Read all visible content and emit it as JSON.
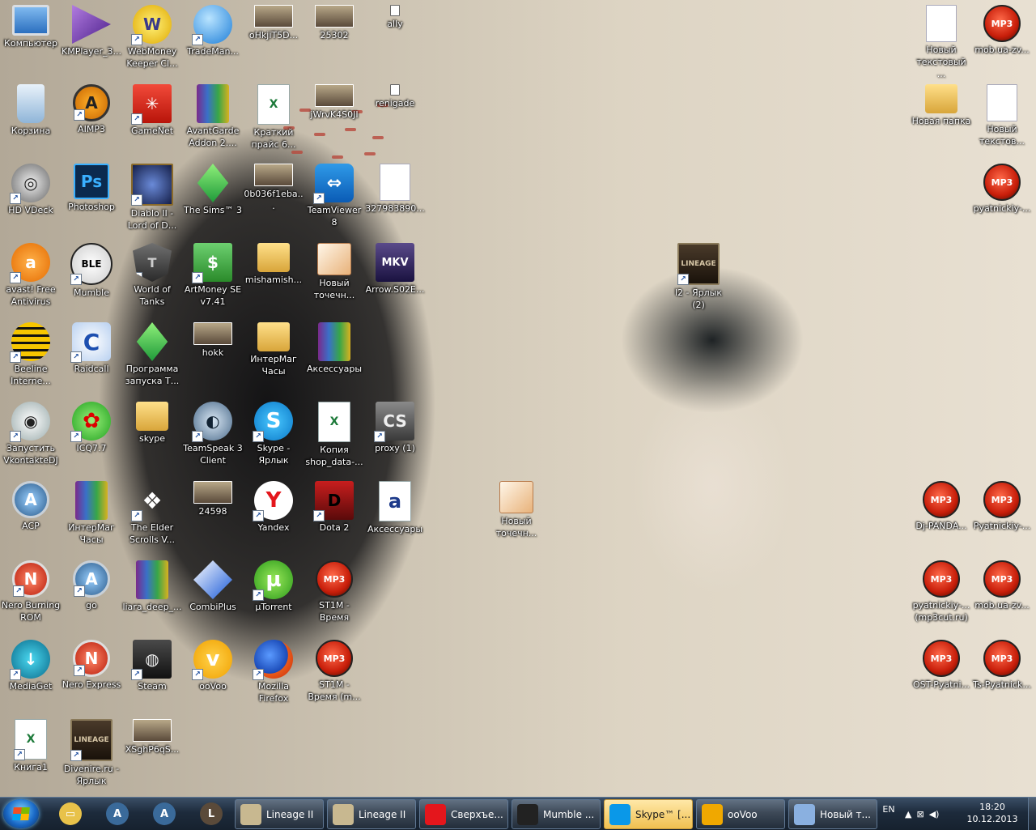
{
  "desktop": {
    "icons": [
      {
        "label": "Компьютер",
        "glyph": "",
        "icon": "computer-icon",
        "style": "g-comp",
        "col": 0,
        "row": 0,
        "shortcut": false
      },
      {
        "label": "KMPlayer_3...",
        "glyph": "",
        "icon": "kmplayer-icon",
        "style": "g-km",
        "col": 1,
        "row": 0,
        "shortcut": false
      },
      {
        "label": "WebMoney Keeper Cl...",
        "glyph": "W",
        "icon": "webmoney-icon",
        "style": "g-wm",
        "col": 2,
        "row": 0,
        "shortcut": true
      },
      {
        "label": "TradeMan...",
        "glyph": "",
        "icon": "trademan-icon",
        "style": "g-trade",
        "col": 3,
        "row": 0,
        "shortcut": true
      },
      {
        "label": "oHkjiT5D...",
        "glyph": "",
        "icon": "image-file-icon",
        "style": "g-img",
        "col": 4,
        "row": 0,
        "shortcut": false
      },
      {
        "label": "25302",
        "glyph": "",
        "icon": "image-file-icon",
        "style": "g-img",
        "col": 5,
        "row": 0,
        "shortcut": false
      },
      {
        "label": "ally",
        "glyph": "",
        "icon": "small-file-icon",
        "style": "g-small",
        "col": 6,
        "row": 0,
        "shortcut": false
      },
      {
        "label": "Корзина",
        "glyph": "",
        "icon": "recycle-bin-icon",
        "style": "g-recycle",
        "col": 0,
        "row": 1,
        "shortcut": false
      },
      {
        "label": "AIMP3",
        "glyph": "A",
        "icon": "aimp-icon",
        "style": "g-aimp",
        "col": 1,
        "row": 1,
        "shortcut": true
      },
      {
        "label": "GameNet",
        "glyph": "✳",
        "icon": "gamenet-icon",
        "style": "g-gamenet",
        "col": 2,
        "row": 1,
        "shortcut": true
      },
      {
        "label": "AvantGarde Addon 2....",
        "glyph": "",
        "icon": "winrar-archive-icon",
        "style": "g-rar",
        "col": 3,
        "row": 1,
        "shortcut": false
      },
      {
        "label": "Краткий прайс 6...",
        "glyph": "X",
        "icon": "excel-file-icon",
        "style": "g-excel",
        "col": 4,
        "row": 1,
        "shortcut": false
      },
      {
        "label": "jWrvK4S0JI",
        "glyph": "",
        "icon": "image-file-icon",
        "style": "g-img",
        "col": 5,
        "row": 1,
        "shortcut": false
      },
      {
        "label": "renigade",
        "glyph": "",
        "icon": "small-file-icon",
        "style": "g-small",
        "col": 6,
        "row": 1,
        "shortcut": false
      },
      {
        "label": "HD VDeck",
        "glyph": "◎",
        "icon": "hd-vdeck-icon",
        "style": "g-hd",
        "col": 0,
        "row": 2,
        "shortcut": true
      },
      {
        "label": "Photoshop",
        "glyph": "Ps",
        "icon": "photoshop-icon",
        "style": "g-ps",
        "col": 1,
        "row": 2,
        "shortcut": false
      },
      {
        "label": "Diablo II - Lord of D...",
        "glyph": "",
        "icon": "diablo-icon",
        "style": "g-diablo",
        "col": 2,
        "row": 2,
        "shortcut": true
      },
      {
        "label": "The Sims™ 3",
        "glyph": "",
        "icon": "sims-icon",
        "style": "g-sims",
        "col": 3,
        "row": 2,
        "shortcut": true
      },
      {
        "label": "0b036f1eba...",
        "glyph": "",
        "icon": "image-file-icon",
        "style": "g-img",
        "col": 4,
        "row": 2,
        "shortcut": false
      },
      {
        "label": "TeamViewer 8",
        "glyph": "⇔",
        "icon": "teamviewer-icon",
        "style": "g-tv",
        "col": 5,
        "row": 2,
        "shortcut": true
      },
      {
        "label": "327983890...",
        "glyph": "",
        "icon": "blank-file-icon",
        "style": "g-file",
        "col": 6,
        "row": 2,
        "shortcut": false
      },
      {
        "label": "avast! Free Antivirus",
        "glyph": "a",
        "icon": "avast-icon",
        "style": "g-avast",
        "col": 0,
        "row": 3,
        "shortcut": true
      },
      {
        "label": "Mumble",
        "glyph": "BLE",
        "icon": "mumble-icon",
        "style": "g-mumble",
        "col": 1,
        "row": 3,
        "shortcut": true
      },
      {
        "label": "World of Tanks",
        "glyph": "T",
        "icon": "world-of-tanks-icon",
        "style": "g-wot",
        "col": 2,
        "row": 3,
        "shortcut": true
      },
      {
        "label": "ArtMoney SE v7.41",
        "glyph": "$",
        "icon": "artmoney-icon",
        "style": "g-money",
        "col": 3,
        "row": 3,
        "shortcut": true
      },
      {
        "label": "mishamish...",
        "glyph": "",
        "icon": "folder-icon",
        "style": "g-folder",
        "col": 4,
        "row": 3,
        "shortcut": false
      },
      {
        "label": "Новый точечн...",
        "glyph": "",
        "icon": "paint-image-icon",
        "style": "g-paint",
        "col": 5,
        "row": 3,
        "shortcut": false
      },
      {
        "label": "Arrow.S02E...",
        "glyph": "MKV",
        "icon": "mkv-video-icon",
        "style": "g-mkv",
        "col": 6,
        "row": 3,
        "shortcut": false
      },
      {
        "label": "Beeline Interne...",
        "glyph": "",
        "icon": "beeline-icon",
        "style": "g-beeline",
        "col": 0,
        "row": 4,
        "shortcut": true
      },
      {
        "label": "Raidcall",
        "glyph": "C",
        "icon": "raidcall-icon",
        "style": "g-raid",
        "col": 1,
        "row": 4,
        "shortcut": true
      },
      {
        "label": "Программа запуска Т...",
        "glyph": "",
        "icon": "sims-launcher-icon",
        "style": "g-sims",
        "col": 2,
        "row": 4,
        "shortcut": true
      },
      {
        "label": "hokk",
        "glyph": "",
        "icon": "image-file-icon",
        "style": "g-img",
        "col": 3,
        "row": 4,
        "shortcut": false
      },
      {
        "label": "ИнтерМаг Часы",
        "glyph": "",
        "icon": "folder-icon",
        "style": "g-folder",
        "col": 4,
        "row": 4,
        "shortcut": false
      },
      {
        "label": "Аксессуары",
        "glyph": "",
        "icon": "winrar-archive-icon",
        "style": "g-rar",
        "col": 5,
        "row": 4,
        "shortcut": false
      },
      {
        "label": "Запустить VkontakteDJ",
        "glyph": "◉",
        "icon": "vkontaktedj-icon",
        "style": "g-vk",
        "col": 0,
        "row": 5,
        "shortcut": true
      },
      {
        "label": "ICQ7.7",
        "glyph": "✿",
        "icon": "icq-icon",
        "style": "g-icq",
        "col": 1,
        "row": 5,
        "shortcut": true
      },
      {
        "label": "skype",
        "glyph": "",
        "icon": "folder-icon",
        "style": "g-folder",
        "col": 2,
        "row": 5,
        "shortcut": false
      },
      {
        "label": "TeamSpeak 3 Client",
        "glyph": "◐",
        "icon": "teamspeak-icon",
        "style": "g-ts",
        "col": 3,
        "row": 5,
        "shortcut": true
      },
      {
        "label": "Skype - Ярлык",
        "glyph": "S",
        "icon": "skype-icon",
        "style": "g-skype",
        "col": 4,
        "row": 5,
        "shortcut": true
      },
      {
        "label": "Копия shop_data-...",
        "glyph": "X",
        "icon": "excel-file-icon",
        "style": "g-excel",
        "col": 5,
        "row": 5,
        "shortcut": false
      },
      {
        "label": "proxy (1)",
        "glyph": "CS",
        "icon": "counter-strike-icon",
        "style": "g-cs",
        "col": 6,
        "row": 5,
        "shortcut": true
      },
      {
        "label": "ACP",
        "glyph": "A",
        "icon": "acp-icon",
        "style": "g-acp",
        "col": 0,
        "row": 6,
        "shortcut": false
      },
      {
        "label": "ИнтерМаг Часы",
        "glyph": "",
        "icon": "winrar-archive-icon",
        "style": "g-rar",
        "col": 1,
        "row": 6,
        "shortcut": false
      },
      {
        "label": "The Elder Scrolls V...",
        "glyph": "❖",
        "icon": "skyrim-icon",
        "style": "g-tes",
        "col": 2,
        "row": 6,
        "shortcut": true
      },
      {
        "label": "24598",
        "glyph": "",
        "icon": "image-file-icon",
        "style": "g-img",
        "col": 3,
        "row": 6,
        "shortcut": false
      },
      {
        "label": "Yandex",
        "glyph": "Y",
        "icon": "yandex-browser-icon",
        "style": "g-yandex",
        "col": 4,
        "row": 6,
        "shortcut": true
      },
      {
        "label": "Dota 2",
        "glyph": "D",
        "icon": "dota2-icon",
        "style": "g-dota",
        "col": 5,
        "row": 6,
        "shortcut": true
      },
      {
        "label": "Аксессуары",
        "glyph": "a",
        "icon": "text-document-icon",
        "style": "g-doc",
        "col": 6,
        "row": 6,
        "shortcut": false
      },
      {
        "label": "Новый точечн...",
        "glyph": "",
        "icon": "paint-image-icon",
        "style": "g-paint",
        "col": 8,
        "row": 6,
        "shortcut": false
      },
      {
        "label": "Nero Burning ROM",
        "glyph": "N",
        "icon": "nero-burning-rom-icon",
        "style": "g-nero",
        "col": 0,
        "row": 7,
        "shortcut": true
      },
      {
        "label": "go",
        "glyph": "A",
        "icon": "go-icon",
        "style": "g-acp",
        "col": 1,
        "row": 7,
        "shortcut": true
      },
      {
        "label": "liara_deep_...",
        "glyph": "",
        "icon": "winrar-archive-icon",
        "style": "g-rar",
        "col": 2,
        "row": 7,
        "shortcut": false
      },
      {
        "label": "CombiPlus",
        "glyph": "",
        "icon": "combiplus-icon",
        "style": "g-combi",
        "col": 3,
        "row": 7,
        "shortcut": false
      },
      {
        "label": "µTorrent",
        "glyph": "µ",
        "icon": "utorrent-icon",
        "style": "g-utor",
        "col": 4,
        "row": 7,
        "shortcut": true
      },
      {
        "label": "ST1M - Время",
        "glyph": "MP3",
        "icon": "mp3-file-icon",
        "style": "g-mp3",
        "col": 5,
        "row": 7,
        "shortcut": false
      },
      {
        "label": "MediaGet",
        "glyph": "↓",
        "icon": "mediaget-icon",
        "style": "g-mediaget",
        "col": 0,
        "row": 8,
        "shortcut": true
      },
      {
        "label": "Nero Express",
        "glyph": "N",
        "icon": "nero-express-icon",
        "style": "g-nero",
        "col": 1,
        "row": 8,
        "shortcut": true
      },
      {
        "label": "Steam",
        "glyph": "◍",
        "icon": "steam-icon",
        "style": "g-steam",
        "col": 2,
        "row": 8,
        "shortcut": true
      },
      {
        "label": "ooVoo",
        "glyph": "v",
        "icon": "oovoo-icon",
        "style": "g-oovoo",
        "col": 3,
        "row": 8,
        "shortcut": true
      },
      {
        "label": "Mozilla Firefox",
        "glyph": "",
        "icon": "firefox-icon",
        "style": "g-firefox",
        "col": 4,
        "row": 8,
        "shortcut": true
      },
      {
        "label": "ST1M - Время (m...",
        "glyph": "MP3",
        "icon": "mp3-file-icon",
        "style": "g-mp3",
        "col": 5,
        "row": 8,
        "shortcut": false
      },
      {
        "label": "Книга1",
        "glyph": "X",
        "icon": "excel-file-icon",
        "style": "g-excel",
        "col": 0,
        "row": 9,
        "shortcut": true
      },
      {
        "label": "Divenire.ru - Ярлык",
        "glyph": "LINEAGE",
        "icon": "lineage-icon",
        "style": "g-lineage",
        "col": 1,
        "row": 9,
        "shortcut": true
      },
      {
        "label": "XSghP6qS...",
        "glyph": "",
        "icon": "image-file-icon",
        "style": "g-img",
        "col": 2,
        "row": 9,
        "shortcut": false
      },
      {
        "label": "l2 - Ярлык (2)",
        "glyph": "LINEAGE",
        "icon": "lineage-icon",
        "style": "g-lineage",
        "col": 11,
        "row": 3,
        "shortcut": true
      },
      {
        "label": "Новый текстовый ...",
        "glyph": "",
        "icon": "text-file-icon",
        "style": "g-file",
        "col": 15,
        "row": 0,
        "shortcut": false
      },
      {
        "label": "mob.ua-zv...",
        "glyph": "MP3",
        "icon": "mp3-file-icon",
        "style": "g-mp3",
        "col": 16,
        "row": 0,
        "shortcut": false
      },
      {
        "label": "Новая папка",
        "glyph": "",
        "icon": "folder-icon",
        "style": "g-folder",
        "col": 15,
        "row": 1,
        "shortcut": false
      },
      {
        "label": "Новый текстов...",
        "glyph": "",
        "icon": "text-file-icon",
        "style": "g-file",
        "col": 16,
        "row": 1,
        "shortcut": false
      },
      {
        "label": "pyatnickiy-...",
        "glyph": "MP3",
        "icon": "mp3-file-icon",
        "style": "g-mp3",
        "col": 16,
        "row": 2,
        "shortcut": false
      },
      {
        "label": "Dj-PANDA...",
        "glyph": "MP3",
        "icon": "mp3-file-icon",
        "style": "g-mp3",
        "col": 15,
        "row": 6,
        "shortcut": false
      },
      {
        "label": "Pyatnickiy-...",
        "glyph": "MP3",
        "icon": "mp3-file-icon",
        "style": "g-mp3",
        "col": 16,
        "row": 6,
        "shortcut": false
      },
      {
        "label": "pyatnickiy-... (mp3cut.ru)",
        "glyph": "MP3",
        "icon": "mp3-file-icon",
        "style": "g-mp3",
        "col": 15,
        "row": 7,
        "shortcut": false
      },
      {
        "label": "mob.ua-zv...",
        "glyph": "MP3",
        "icon": "mp3-file-icon",
        "style": "g-mp3",
        "col": 16,
        "row": 7,
        "shortcut": false
      },
      {
        "label": "OST-Pyatni...",
        "glyph": "MP3",
        "icon": "mp3-file-icon",
        "style": "g-mp3",
        "col": 15,
        "row": 8,
        "shortcut": false
      },
      {
        "label": "Ts-Pyatnick...",
        "glyph": "MP3",
        "icon": "mp3-file-icon",
        "style": "g-mp3",
        "col": 16,
        "row": 8,
        "shortcut": false
      }
    ]
  },
  "taskbar": {
    "pinned": [
      {
        "icon": "windows-explorer-icon",
        "glyph": "▭",
        "color": "#e8c24a"
      },
      {
        "icon": "acp-icon",
        "glyph": "A",
        "color": "#3a6a9a"
      },
      {
        "icon": "go-icon",
        "glyph": "A",
        "color": "#3a6a9a"
      },
      {
        "icon": "lineage-icon",
        "glyph": "L",
        "color": "#5a4a3a"
      }
    ],
    "buttons": [
      {
        "label": "Lineage II",
        "icon": "lineage-icon",
        "color": "#c8b890",
        "active": false
      },
      {
        "label": "Lineage II",
        "icon": "lineage-icon",
        "color": "#c8b890",
        "active": false
      },
      {
        "label": "Сверхъе...",
        "icon": "yandex-browser-icon",
        "color": "#e4161c",
        "active": false
      },
      {
        "label": "Mumble ...",
        "icon": "mumble-icon",
        "color": "#222222",
        "active": false
      },
      {
        "label": "Skype™ [...",
        "icon": "skype-icon",
        "color": "#0a98e8",
        "active": true
      },
      {
        "label": "ooVoo",
        "icon": "oovoo-icon",
        "color": "#f0a800",
        "active": false
      },
      {
        "label": "Новый т...",
        "icon": "paint-icon",
        "color": "#8ab0e0",
        "active": false
      }
    ],
    "language": "EN",
    "time": "18:20",
    "date": "10.12.2013"
  }
}
